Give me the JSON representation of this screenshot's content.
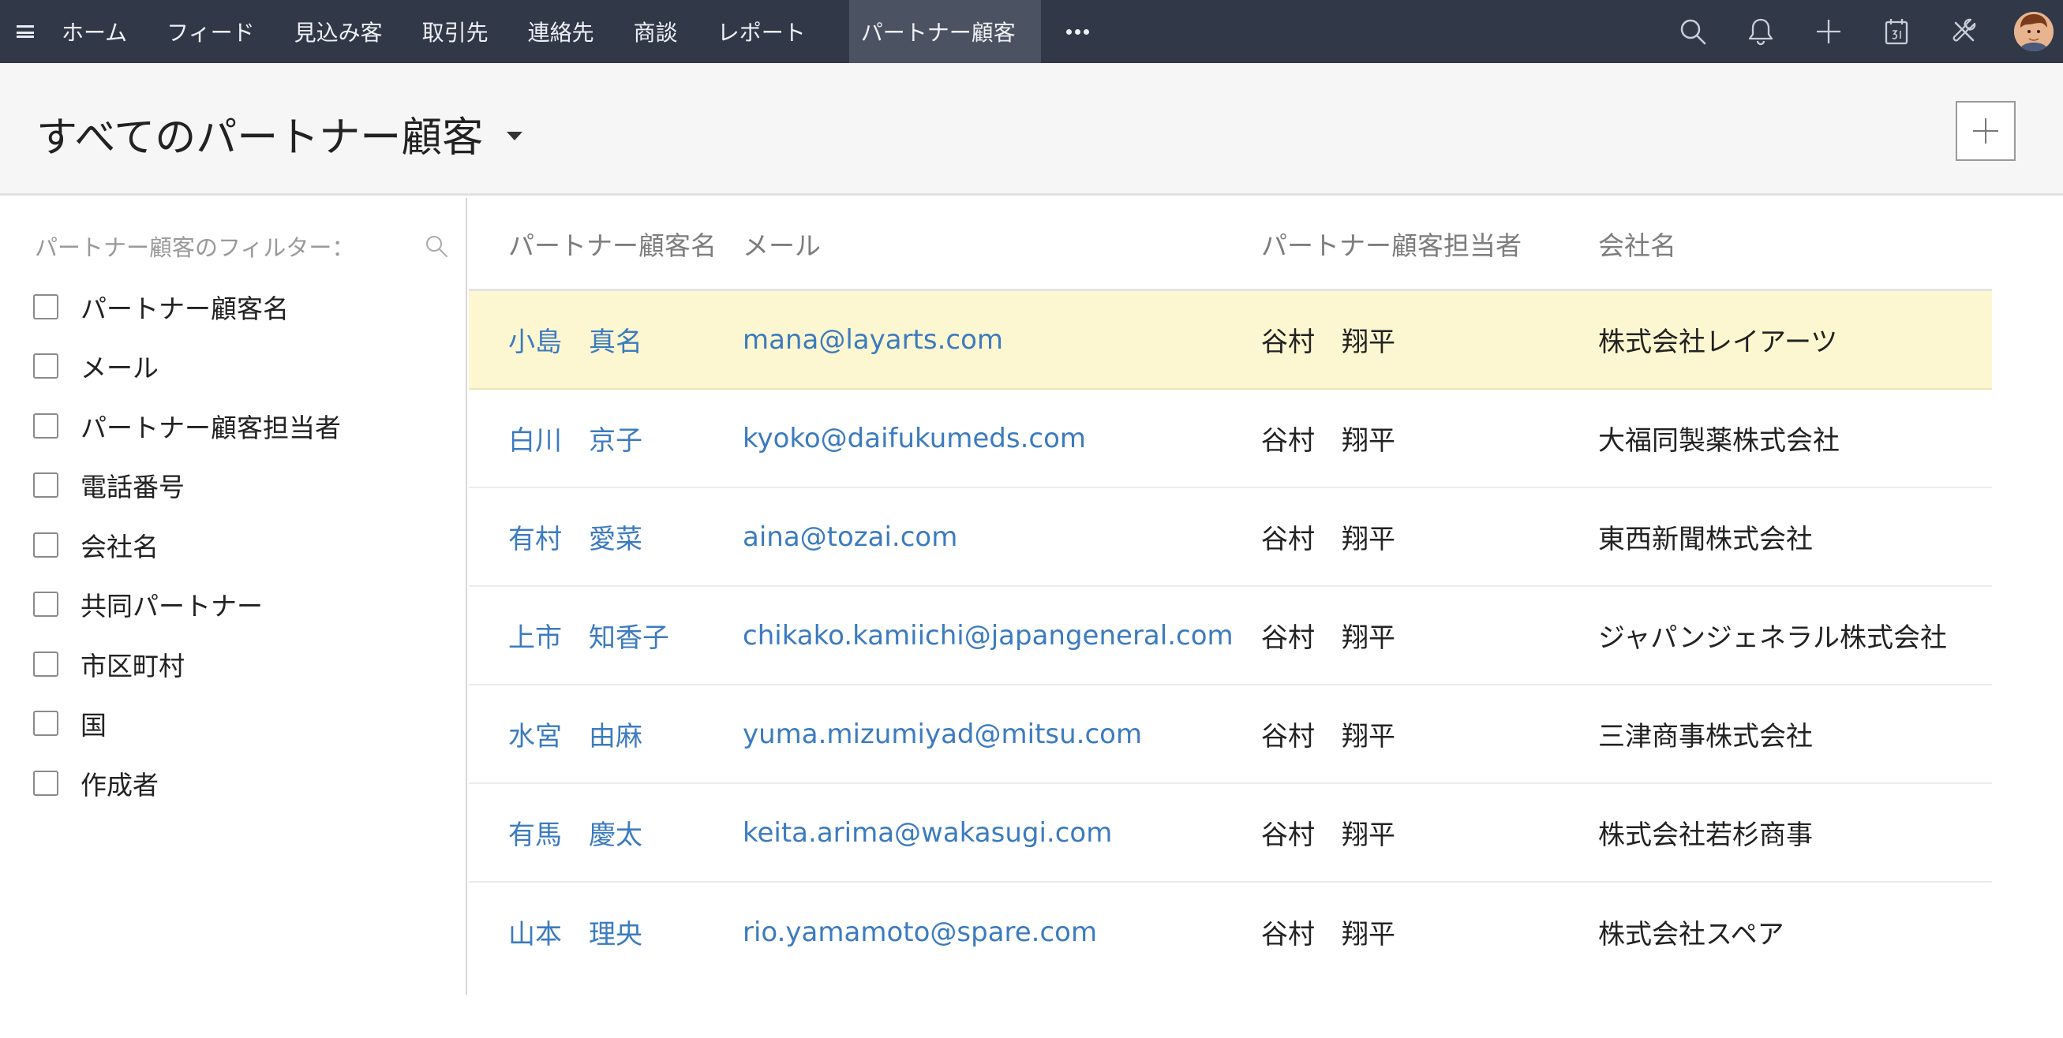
{
  "nav": {
    "tabs": [
      "ホーム",
      "フィード",
      "見込み客",
      "取引先",
      "連絡先",
      "商談",
      "レポート"
    ],
    "active_tab": "パートナー顧客"
  },
  "colors": {
    "nav_bg": "#313949",
    "active_tab_bg": "#4b5261",
    "link": "#3c7bbf",
    "highlight_row": "#fdf7d1"
  },
  "header": {
    "title": "すべてのパートナー顧客"
  },
  "sidebar": {
    "filter_title": "パートナー顧客のフィルター：",
    "filters": [
      "パートナー顧客名",
      "メール",
      "パートナー顧客担当者",
      "電話番号",
      "会社名",
      "共同パートナー",
      "市区町村",
      "国",
      "作成者"
    ]
  },
  "table": {
    "headers": [
      "パートナー顧客名",
      "メール",
      "パートナー顧客担当者",
      "会社名"
    ],
    "rows": [
      {
        "name": "小島　真名",
        "email": "mana@layarts.com",
        "owner": "谷村　翔平",
        "company": "株式会社レイアーツ"
      },
      {
        "name": "白川　京子",
        "email": "kyoko@daifukumeds.com",
        "owner": "谷村　翔平",
        "company": "大福同製薬株式会社"
      },
      {
        "name": "有村　愛菜",
        "email": "aina@tozai.com",
        "owner": "谷村　翔平",
        "company": "東西新聞株式会社"
      },
      {
        "name": "上市　知香子",
        "email": "chikako.kamiichi@japangeneral.com",
        "owner": "谷村　翔平",
        "company": "ジャパンジェネラル株式会社"
      },
      {
        "name": "水宮　由麻",
        "email": "yuma.mizumiyad@mitsu.com",
        "owner": "谷村　翔平",
        "company": "三津商事株式会社"
      },
      {
        "name": "有馬　慶太",
        "email": "keita.arima@wakasugi.com",
        "owner": "谷村　翔平",
        "company": "株式会社若杉商事"
      },
      {
        "name": "山本　理央",
        "email": "rio.yamamoto@spare.com",
        "owner": "谷村　翔平",
        "company": "株式会社スペア"
      }
    ]
  }
}
